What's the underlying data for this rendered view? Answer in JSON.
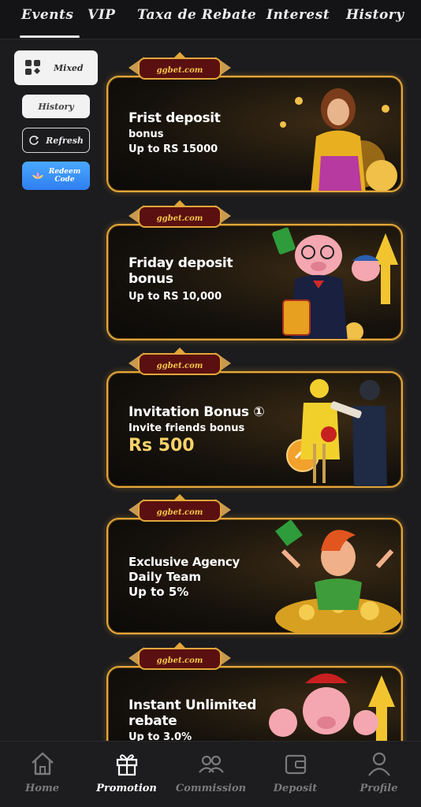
{
  "tabs": [
    "Events",
    "VIP",
    "Taxa de Rebate",
    "Interest",
    "History"
  ],
  "side_menu": {
    "mixed": "Mixed",
    "history": "History",
    "refresh": "Refresh",
    "redeem": [
      "Redeem",
      "Code"
    ]
  },
  "badge_text": "ggbet.com",
  "promotions": [
    {
      "title": "Frist deposit",
      "lines": [
        "bonus",
        "Up to RS 15000"
      ],
      "big": ""
    },
    {
      "title": "Friday deposit bonus",
      "lines": [
        "Up to RS 10,000"
      ],
      "big": ""
    },
    {
      "title": "Invitation Bonus ①",
      "lines": [
        "Invite friends bonus"
      ],
      "big": "Rs 500"
    },
    {
      "title": "Exclusive Agency",
      "lines": [
        "Daily Team",
        "Up to 5%"
      ],
      "big": ""
    },
    {
      "title": "Instant Unlimited rebate",
      "lines": [
        "Up to 3.0%"
      ],
      "big": ""
    }
  ],
  "bottom_nav": {
    "items": [
      {
        "label": "Home",
        "icon": "home-icon"
      },
      {
        "label": "Promotion",
        "icon": "gift-icon"
      },
      {
        "label": "Commission",
        "icon": "users-icon"
      },
      {
        "label": "Deposit",
        "icon": "wallet-icon"
      },
      {
        "label": "Profile",
        "icon": "person-icon"
      }
    ],
    "active": "Promotion"
  },
  "colors": {
    "accent_gold": "#e2a63a",
    "background": "#1c1c1e",
    "redeem_blue": "#3b8ff5"
  }
}
